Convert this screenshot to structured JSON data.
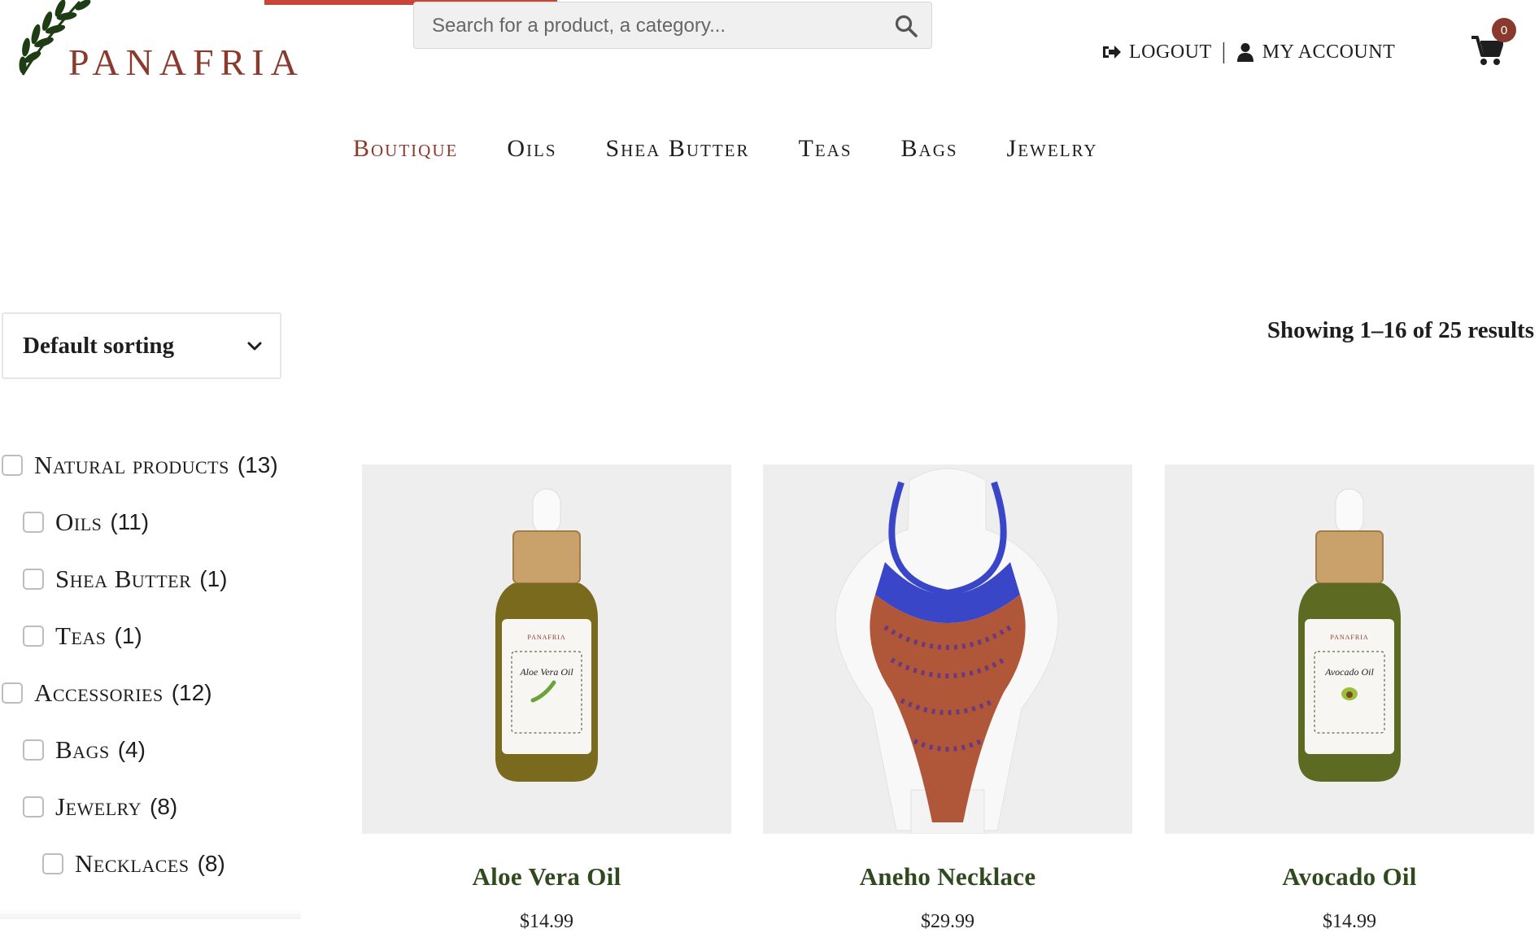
{
  "header": {
    "logo_text": "PANAFRIA",
    "search_placeholder": "Search for a product, a category...",
    "logout_label": "LOGOUT",
    "separator": "|",
    "account_label": "MY ACCOUNT",
    "cart_count": "0",
    "accent_color": "#8a3a2c",
    "progress_color": "#c8453a"
  },
  "nav": {
    "items": [
      {
        "label": "Boutique",
        "active": true
      },
      {
        "label": "Oils"
      },
      {
        "label": "Shea Butter"
      },
      {
        "label": "Teas"
      },
      {
        "label": "Bags"
      },
      {
        "label": "Jewelry"
      }
    ]
  },
  "toolbar": {
    "sort_selected": "Default sorting",
    "result_count": "Showing 1–16 of 25 results"
  },
  "filters": [
    {
      "label": "Natural products",
      "count": "(13)"
    },
    {
      "label": "Oils",
      "count": "(11)"
    },
    {
      "label": "Shea Butter",
      "count": "(1)"
    },
    {
      "label": "Teas",
      "count": "(1)"
    },
    {
      "label": "Accessories",
      "count": "(12)"
    },
    {
      "label": "Bags",
      "count": "(4)"
    },
    {
      "label": "Jewelry",
      "count": "(8)"
    },
    {
      "label": "Necklaces",
      "count": "(8)"
    }
  ],
  "products": [
    {
      "name": "Aloe Vera Oil",
      "price": "$14.99",
      "brand": "PANAFRIA",
      "label_script": "Aloe Vera Oil",
      "image_icon": "oil-bottle"
    },
    {
      "name": "Aneho Necklace",
      "price": "$29.99",
      "image_icon": "beaded-necklace"
    },
    {
      "name": "Avocado Oil",
      "price": "$14.99",
      "brand": "PANAFRIA",
      "label_script": "Avocado Oil",
      "image_icon": "oil-bottle"
    }
  ]
}
